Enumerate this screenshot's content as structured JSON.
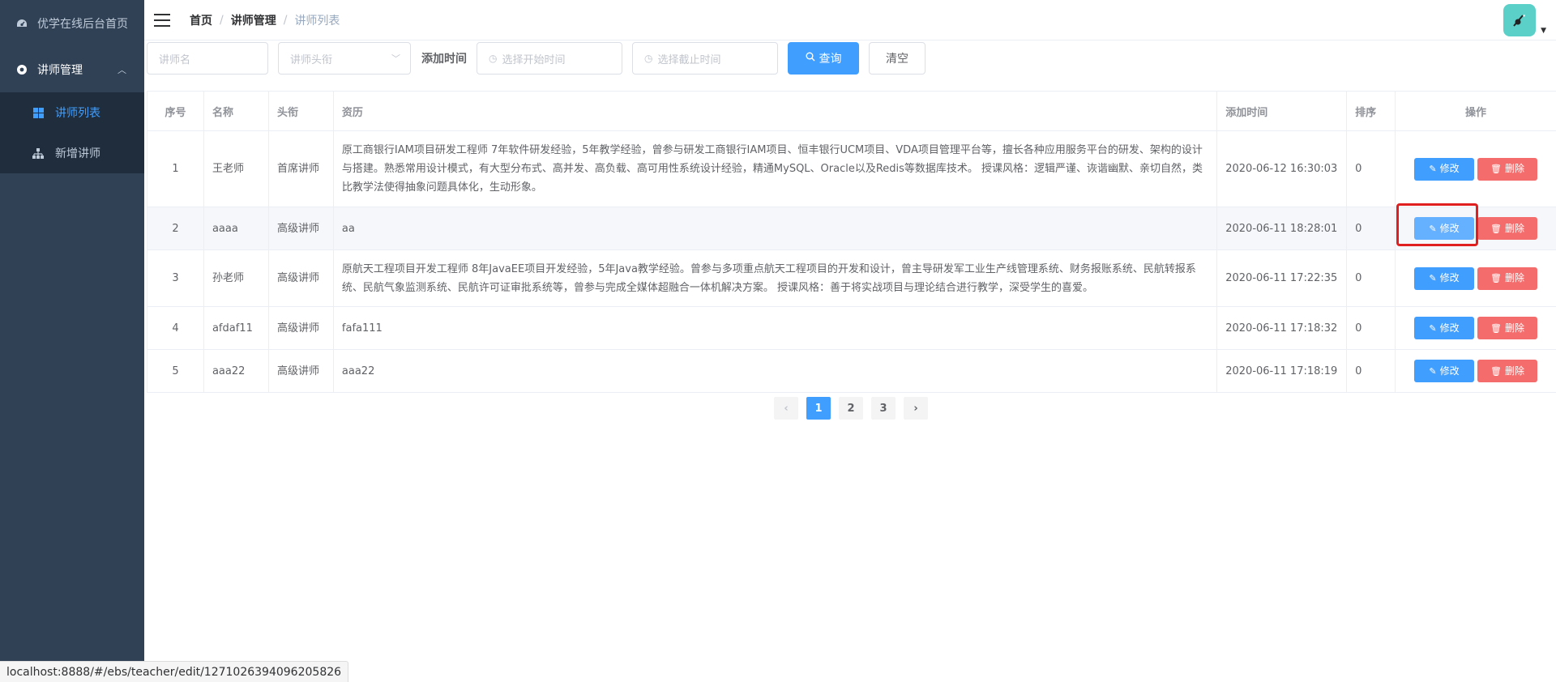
{
  "sidebar": {
    "home": {
      "label": "优学在线后台首页",
      "icon": "dashboard-icon"
    },
    "teacher_mgmt": {
      "label": "讲师管理",
      "icon": "gear-icon",
      "expanded": true
    },
    "sub_items": [
      {
        "label": "讲师列表",
        "icon": "grid-icon",
        "active": true
      },
      {
        "label": "新增讲师",
        "icon": "org-chart-icon",
        "active": false
      }
    ]
  },
  "navbar": {
    "breadcrumb": [
      "首页",
      "讲师管理",
      "讲师列表"
    ],
    "separator": "/"
  },
  "filters": {
    "name_placeholder": "讲师名",
    "title_placeholder": "讲师头衔",
    "time_label": "添加时间",
    "start_placeholder": "选择开始时间",
    "end_placeholder": "选择截止时间",
    "search_label": "查询",
    "clear_label": "清空"
  },
  "table": {
    "headers": [
      "序号",
      "名称",
      "头衔",
      "资历",
      "添加时间",
      "排序",
      "操作"
    ],
    "rows": [
      {
        "idx": "1",
        "name": "王老师",
        "title": "首席讲师",
        "resume": "原工商银行IAM项目研发工程师 7年软件研发经验，5年教学经验，曾参与研发工商银行IAM项目、恒丰银行UCM项目、VDA项目管理平台等，擅长各种应用服务平台的研发、架构的设计与搭建。熟悉常用设计模式，有大型分布式、高并发、高负载、高可用性系统设计经验，精通MySQL、Oracle以及Redis等数据库技术。 授课风格：逻辑严谨、诙谐幽默、亲切自然，类比教学法使得抽象问题具体化，生动形象。",
        "time": "2020-06-12 16:30:03",
        "sort": "0"
      },
      {
        "idx": "2",
        "name": "aaaa",
        "title": "高级讲师",
        "resume": "aa",
        "time": "2020-06-11 18:28:01",
        "sort": "0"
      },
      {
        "idx": "3",
        "name": "孙老师",
        "title": "高级讲师",
        "resume": "原航天工程项目开发工程师 8年JavaEE项目开发经验，5年Java教学经验。曾参与多项重点航天工程项目的开发和设计，曾主导研发军工业生产线管理系统、财务报账系统、民航转报系统、民航气象监测系统、民航许可证审批系统等，曾参与完成全媒体超融合一体机解决方案。 授课风格：善于将实战项目与理论结合进行教学，深受学生的喜爱。",
        "time": "2020-06-11 17:22:35",
        "sort": "0"
      },
      {
        "idx": "4",
        "name": "afdaf11",
        "title": "高级讲师",
        "resume": "fafa111",
        "time": "2020-06-11 17:18:32",
        "sort": "0"
      },
      {
        "idx": "5",
        "name": "aaa22",
        "title": "高级讲师",
        "resume": "aaa22",
        "time": "2020-06-11 17:18:19",
        "sort": "0"
      }
    ],
    "edit_label": "修改",
    "delete_label": "删除"
  },
  "pagination": {
    "prev": "‹",
    "pages": [
      "1",
      "2",
      "3"
    ],
    "current": "1",
    "next": "›"
  },
  "statusbar": {
    "url": "localhost:8888/#/ebs/teacher/edit/1271026394096205826"
  },
  "colors": {
    "primary": "#409eff",
    "danger": "#f56c6c",
    "sidebar_bg": "#304156",
    "highlight": "#e02020"
  }
}
